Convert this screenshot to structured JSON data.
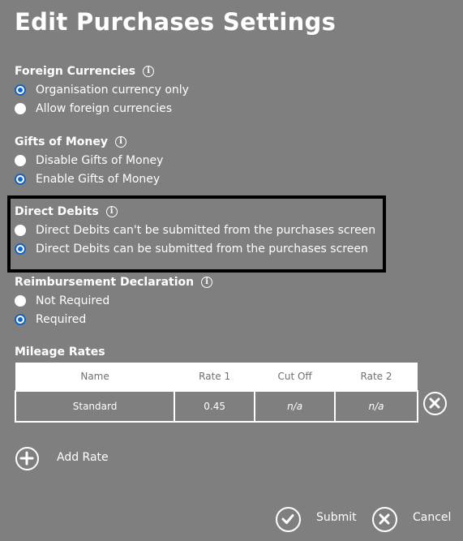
{
  "title": "Edit Purchases Settings",
  "sections": {
    "foreign_currencies": {
      "heading": "Foreign Currencies",
      "options": [
        "Organisation currency only",
        "Allow foreign currencies"
      ],
      "selected": 0
    },
    "gifts_of_money": {
      "heading": "Gifts of Money",
      "options": [
        "Disable Gifts of Money",
        "Enable Gifts of Money"
      ],
      "selected": 1
    },
    "direct_debits": {
      "heading": "Direct Debits",
      "options": [
        "Direct Debits can't be submitted from the purchases screen",
        "Direct Debits can be submitted from the purchases screen"
      ],
      "selected": 1
    },
    "reimbursement_declaration": {
      "heading": "Reimbursement Declaration",
      "options": [
        "Not Required",
        "Required"
      ],
      "selected": 1
    }
  },
  "mileage": {
    "heading": "Mileage Rates",
    "columns": [
      "Name",
      "Rate 1",
      "Cut Off",
      "Rate 2"
    ],
    "rows": [
      {
        "name": "Standard",
        "rate1": "0.45",
        "cutoff": "n/a",
        "rate2": "n/a"
      }
    ]
  },
  "actions": {
    "add_rate": "Add Rate",
    "submit": "Submit",
    "cancel": "Cancel"
  },
  "colors": {
    "background": "#7f7f7f",
    "radio_selected": "#1565c0",
    "highlight_border": "#000000"
  },
  "icons": {
    "info": "info-icon",
    "remove_row": "close-circle-icon",
    "add": "plus-circle-icon",
    "submit": "check-circle-icon",
    "cancel": "x-circle-icon"
  }
}
